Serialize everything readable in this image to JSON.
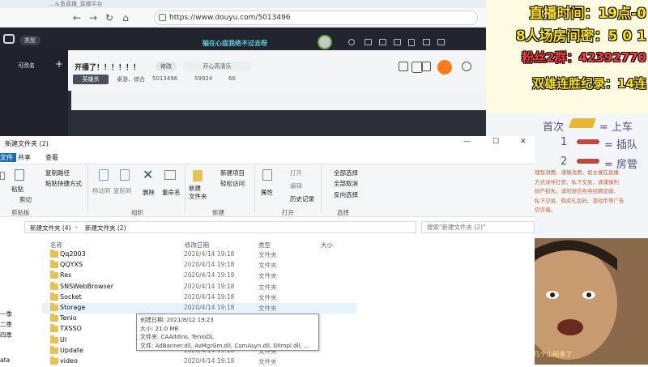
{
  "browser": {
    "tab_title": "…斗鱼直播_直播平台",
    "url": "https://www.douyu.com/5013496",
    "nav_back": "←",
    "nav_forward": "→",
    "nav_refresh": "↻",
    "nav_home": "⌂"
  },
  "douyu": {
    "category_button": "类型",
    "marquee": "输在心底我绝不过去呀",
    "left_panel": {
      "rename": "可改名",
      "add": "+"
    },
    "room": {
      "title": "开播了！！！！！！",
      "edit_button": "修改",
      "tag_input": "开心高清乐",
      "category": "英雄杀",
      "subcategory": "桌游、综合",
      "room_id": "5013496",
      "heat": "59924",
      "fans": "66"
    }
  },
  "overlay": {
    "line1": "直播时间：19点-0",
    "line2": "8人场房间密：5 0 1",
    "line3": "粉丝2群：42392770",
    "line4": "双雄连胜纪录：14连",
    "rule_first": "首次",
    "rule_first_result": "= 上车",
    "rule_one": "1",
    "rule_one_result": "= 插队",
    "rule_two": "2",
    "rule_two_result": "= 房管",
    "tips": "理智消费，谨慎消费，如主播在直播\n方式诱导打赏、私下交易，请谨慎判\n财产损失。请勿轻信各类招聘征婚、\n私下交易、购买礼包码、游戏币等广告\n信诈骗。"
  },
  "portrait": {
    "subtitle": "那就看看我这个 第几个山前来了"
  },
  "explorer": {
    "title": "新建文件夹 (2)",
    "window_controls": {
      "minimize": "—",
      "maximize": "☐",
      "close": "✕"
    },
    "tabs": [
      "文件",
      "共享",
      "查看"
    ],
    "ribbon": {
      "clipboard": {
        "pin": "固定到快速访问",
        "copy": "复制",
        "paste": "粘贴",
        "copy_path": "复制路径",
        "paste_shortcut": "粘贴快捷方式",
        "cut": "剪切",
        "group": "剪贴板"
      },
      "organize": {
        "move_to": "移动到",
        "copy_to": "复制到",
        "delete": "删除",
        "rename": "重命名",
        "group": "组织"
      },
      "new": {
        "new_folder": "新建\n文件夹",
        "new_item": "新建项目",
        "easy_access": "轻松访问",
        "group": "新建"
      },
      "open": {
        "properties": "属性",
        "open": "打开",
        "edit": "编辑",
        "history": "历史记录",
        "group": "打开"
      },
      "select": {
        "select_all": "全部选择",
        "select_none": "全部取消",
        "invert": "反向选择",
        "group": "选择"
      }
    },
    "path": [
      "新建文件夹 (4)",
      "新建文件夹 (2)"
    ],
    "search_placeholder": "搜索\"新建文件夹 (2)\"",
    "columns": {
      "name": "名称",
      "date": "修改日期",
      "type": "类型",
      "size": "大小"
    },
    "files": [
      {
        "name": "Qq2003",
        "date": "2020/4/14 19:18",
        "type": "文件夹"
      },
      {
        "name": "QQYXS",
        "date": "2020/4/14 19:18",
        "type": "文件夹"
      },
      {
        "name": "Res",
        "date": "2020/4/14 19:18",
        "type": "文件夹"
      },
      {
        "name": "SNSWebBrowser",
        "date": "2020/4/14 19:18",
        "type": "文件夹"
      },
      {
        "name": "Socket",
        "date": "2020/4/14 19:18",
        "type": "文件夹"
      },
      {
        "name": "Storage",
        "date": "2020/4/14 19:18",
        "type": "文件夹"
      },
      {
        "name": "Tenio",
        "date": "",
        "type": ""
      },
      {
        "name": "TXSSO",
        "date": "",
        "type": ""
      },
      {
        "name": "UI",
        "date": "",
        "type": ""
      },
      {
        "name": "Update",
        "date": "2020/4/14 19:18",
        "type": "文件夹"
      },
      {
        "name": "video",
        "date": "2020/4/14 19:18",
        "type": "文件夹"
      }
    ],
    "nav_items": [
      "一季",
      "二季",
      "四季",
      "ata"
    ],
    "tooltip": {
      "created": "创建日期: 2021/8/12 19:23",
      "size": "大小: 21.0 MB",
      "folders": "文件夹: CAAddins, TenioDL",
      "files": "文件: AdBanner.dll, AvMgrGm.dll, ComAsyn.dll, DlImpl.dll, ..."
    }
  }
}
